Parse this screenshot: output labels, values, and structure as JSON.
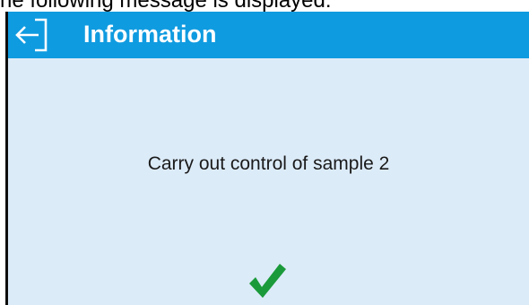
{
  "caption": {
    "text": "he following message is displayed:"
  },
  "header": {
    "title": "Information",
    "back_icon": "exit-arrow-icon",
    "color": "#0f9be0"
  },
  "dialog": {
    "message": "Carry out control of sample 2",
    "background": "#dcebf8"
  },
  "confirm": {
    "icon": "checkmark-icon",
    "color": "#1a9a3a"
  }
}
